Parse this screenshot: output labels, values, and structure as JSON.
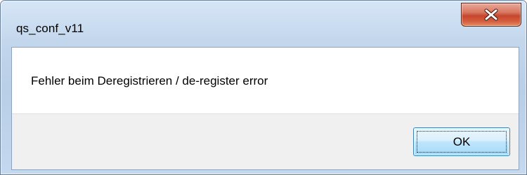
{
  "window": {
    "title": "qs_conf_v11"
  },
  "dialog": {
    "message": "Fehler beim Deregistrieren / de-register error",
    "ok_label": "OK"
  },
  "icons": {
    "close": "close-icon"
  },
  "colors": {
    "close_button": "#c7462b",
    "ok_button_border": "#3c7fb1",
    "frame": "#b9cfe7"
  }
}
